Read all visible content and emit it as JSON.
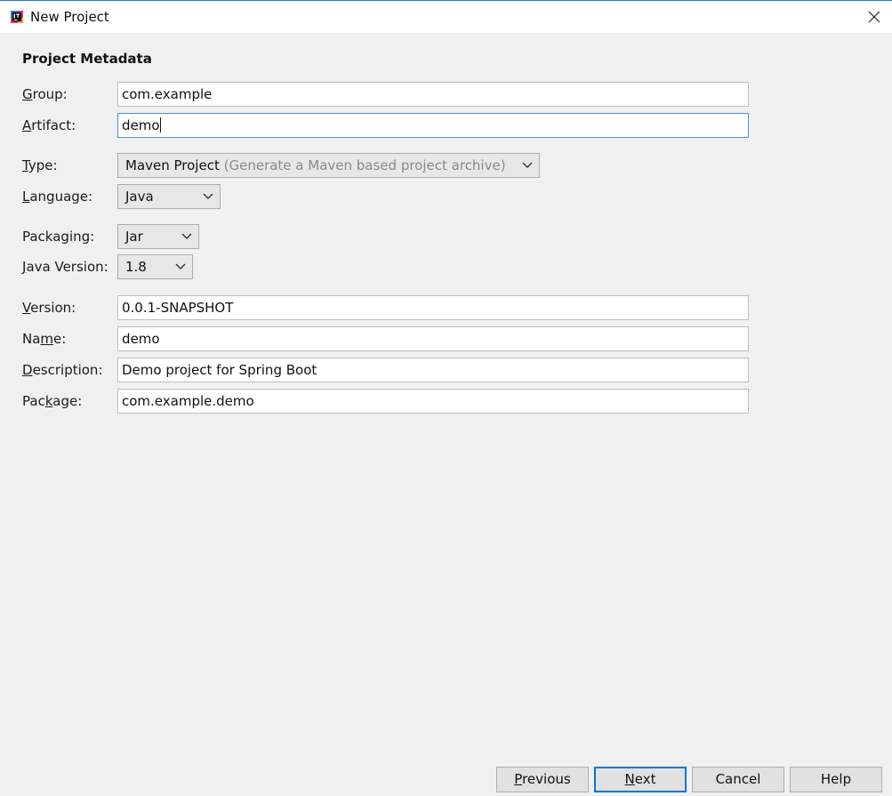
{
  "window": {
    "title": "New Project"
  },
  "heading": "Project Metadata",
  "fields": {
    "group": {
      "label_mnemonic": "G",
      "label_rest": "roup:",
      "value": "com.example"
    },
    "artifact": {
      "label_mnemonic": "A",
      "label_rest": "rtifact:",
      "value": "demo"
    },
    "type": {
      "label_mnemonic": "T",
      "label_rest": "ype:",
      "value": "Maven Project",
      "hint": "(Generate a Maven based project archive)"
    },
    "language": {
      "label_mnemonic": "L",
      "label_rest": "anguage:",
      "value": "Java"
    },
    "packaging": {
      "label_text": "Packaging:",
      "value": "Jar"
    },
    "java_version": {
      "label_mnemonic": "J",
      "label_rest": "ava Version:",
      "value": "1.8"
    },
    "version": {
      "label_mnemonic": "V",
      "label_rest": "ersion:",
      "value": "0.0.1-SNAPSHOT"
    },
    "name": {
      "label_pre": "Na",
      "label_mnemonic": "m",
      "label_rest": "e:",
      "value": "demo"
    },
    "description": {
      "label_mnemonic": "D",
      "label_rest": "escription:",
      "value": "Demo project for Spring Boot"
    },
    "package": {
      "label_pre": "Pac",
      "label_mnemonic": "k",
      "label_rest": "age:",
      "value": "com.example.demo"
    }
  },
  "buttons": {
    "previous": {
      "mnemonic": "P",
      "rest": "revious"
    },
    "next": {
      "mnemonic": "N",
      "rest": "ext"
    },
    "cancel": {
      "label": "Cancel"
    },
    "help": {
      "label": "Help"
    }
  },
  "icons": {
    "app": "intellij-idea-icon",
    "close": "close-icon",
    "dropdown": "chevron-down-icon"
  },
  "colors": {
    "accent": "#0078d7",
    "focus_border": "#4a90d9",
    "background": "#f0f0f0"
  }
}
